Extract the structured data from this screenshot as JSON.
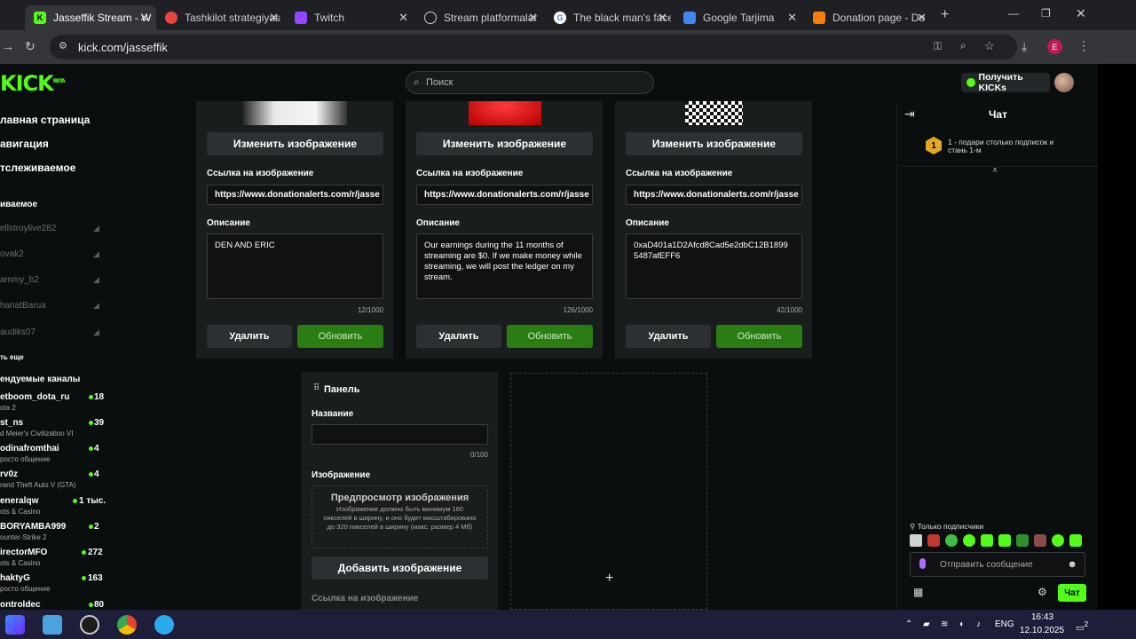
{
  "browser": {
    "tabs": [
      {
        "title": "Jasseffik Stream - W",
        "active": true,
        "icon": "kick-icon",
        "color": "#53fc18"
      },
      {
        "title": "Tashkilot strategiyas",
        "active": false,
        "icon": "opera-icon",
        "color": "#e8453c"
      },
      {
        "title": "Twitch",
        "active": false,
        "icon": "twitch-icon",
        "color": "#9146ff"
      },
      {
        "title": "Stream platformalar",
        "active": false,
        "icon": "globe-icon",
        "color": "#cccccc"
      },
      {
        "title": "The black man's face",
        "active": false,
        "icon": "google-icon",
        "color": "#ffffff"
      },
      {
        "title": "Google Tarjima",
        "active": false,
        "icon": "translate-icon",
        "color": "#4285f4"
      },
      {
        "title": "Donation page - Do",
        "active": false,
        "icon": "donationalerts-icon",
        "color": "#f57d0d"
      }
    ],
    "url": "kick.com/jasseffik",
    "profile_letter": "E"
  },
  "header": {
    "logo": "KICK",
    "logo_badge": "BETA",
    "search_placeholder": "Поиск",
    "get_kicks": "Получить KICKs"
  },
  "sidebar": {
    "nav": [
      "лавная страница",
      "авигация",
      "тслеживаемое"
    ],
    "following_title": "иваемое",
    "following": [
      "ellstroylive282",
      "ovak2",
      "ammy_b2",
      "hanatBarua",
      "audiks07"
    ],
    "show_more": "ть еще",
    "recommended_title": "ендуемые каналы",
    "recommended": [
      {
        "name": "etboom_dota_ru",
        "game": "ota 2",
        "viewers": "18"
      },
      {
        "name": "st_ns",
        "game": "d Meier's Civilization VI",
        "viewers": "39"
      },
      {
        "name": "odinafromthai",
        "game": "росто общение",
        "viewers": "4"
      },
      {
        "name": "rv0z",
        "game": "rand Theft Auto V (GTA)",
        "viewers": "4"
      },
      {
        "name": "eneralqw",
        "game": "ots & Casino",
        "viewers": "1 тыс."
      },
      {
        "name": "BORYAMBA999",
        "game": "ounter-Strike 2",
        "viewers": "2"
      },
      {
        "name": "irectorMFO",
        "game": "ots & Casino",
        "viewers": "272"
      },
      {
        "name": "haktyG",
        "game": "росто общение",
        "viewers": "163"
      },
      {
        "name": "ontroldec",
        "game": "",
        "viewers": "80"
      }
    ]
  },
  "cards": [
    {
      "change_image": "Изменить изображение",
      "link_label": "Ссылка на изображение",
      "link_value": "https://www.donationalerts.com/r/jasse",
      "desc_label": "Описание",
      "desc_value": "DEN AND ERIC",
      "counter": "12/1000",
      "delete": "Удалить",
      "update": "Обновить"
    },
    {
      "change_image": "Изменить изображение",
      "link_label": "Ссылка на изображение",
      "link_value": "https://www.donationalerts.com/r/jasse",
      "desc_label": "Описание",
      "desc_value": "Our earnings during the 11 months of streaming are $0. If we make money while streaming, we will post the ledger on my stream.",
      "counter": "126/1000",
      "delete": "Удалить",
      "update": "Обновить"
    },
    {
      "change_image": "Изменить изображение",
      "link_label": "Ссылка на изображение",
      "link_value": "https://www.donationalerts.com/r/jasse",
      "desc_label": "Описание",
      "desc_value": "0xaD401a1D2Afcd8Cad5e2dbC12B1899 5487afEFF6",
      "counter": "42/1000",
      "delete": "Удалить",
      "update": "Обновить"
    }
  ],
  "panel": {
    "title": "Панель",
    "name_label": "Название",
    "name_value": "",
    "name_counter": "0/100",
    "image_label": "Изображение",
    "preview_title": "Предпросмотр изображения",
    "preview_desc": "Изображение должно быть минимум 160 пикселей в ширину, и оно будет масштабировано до 320 пикселей в ширину (макс. размер 4 Мб)",
    "add_image": "Добавить изображение",
    "link_label": "Ссылка на изображение"
  },
  "chat": {
    "title": "Чат",
    "gift_badge": "1",
    "gift_text": "1 - подари столько подписок и стань 1-м",
    "subscribers_only": "Только подписчики",
    "input_placeholder": "Отправить сообщение",
    "send": "Чат"
  },
  "taskbar": {
    "lang": "ENG",
    "time": "16:43",
    "date": "12.10.2025",
    "notifications": "2"
  }
}
